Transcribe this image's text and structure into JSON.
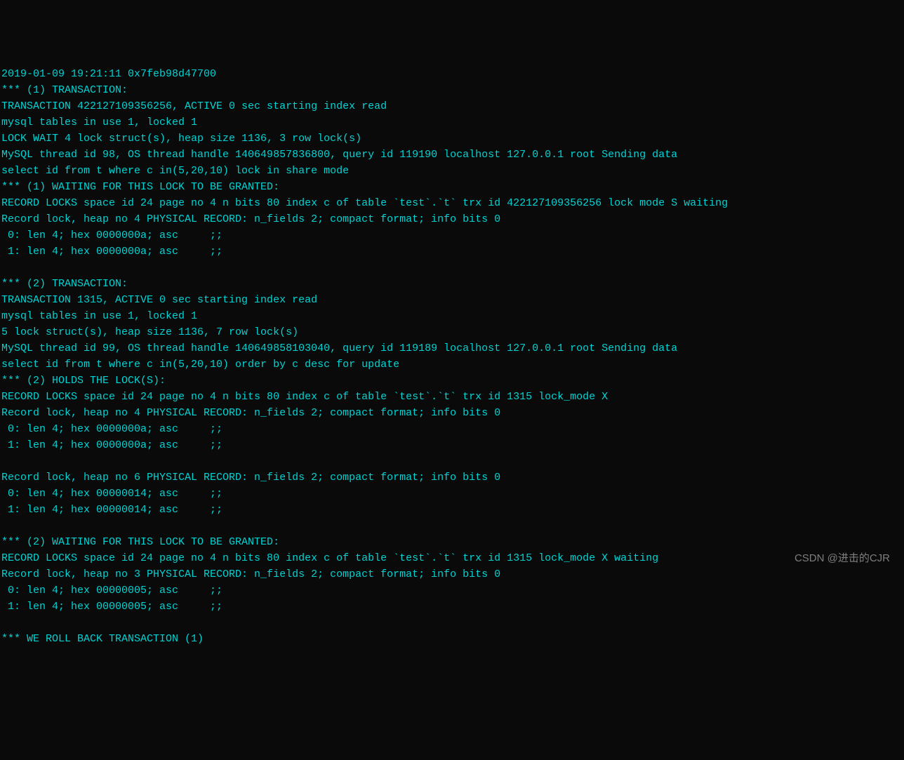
{
  "terminal": {
    "lines": [
      "2019-01-09 19:21:11 0x7feb98d47700",
      "*** (1) TRANSACTION:",
      "TRANSACTION 422127109356256, ACTIVE 0 sec starting index read",
      "mysql tables in use 1, locked 1",
      "LOCK WAIT 4 lock struct(s), heap size 1136, 3 row lock(s)",
      "MySQL thread id 98, OS thread handle 140649857836800, query id 119190 localhost 127.0.0.1 root Sending data",
      "select id from t where c in(5,20,10) lock in share mode",
      "*** (1) WAITING FOR THIS LOCK TO BE GRANTED:",
      "RECORD LOCKS space id 24 page no 4 n bits 80 index c of table `test`.`t` trx id 422127109356256 lock mode S waiting",
      "Record lock, heap no 4 PHYSICAL RECORD: n_fields 2; compact format; info bits 0",
      " 0: len 4; hex 0000000a; asc     ;;",
      " 1: len 4; hex 0000000a; asc     ;;",
      "",
      "*** (2) TRANSACTION:",
      "TRANSACTION 1315, ACTIVE 0 sec starting index read",
      "mysql tables in use 1, locked 1",
      "5 lock struct(s), heap size 1136, 7 row lock(s)",
      "MySQL thread id 99, OS thread handle 140649858103040, query id 119189 localhost 127.0.0.1 root Sending data",
      "select id from t where c in(5,20,10) order by c desc for update",
      "*** (2) HOLDS THE LOCK(S):",
      "RECORD LOCKS space id 24 page no 4 n bits 80 index c of table `test`.`t` trx id 1315 lock_mode X",
      "Record lock, heap no 4 PHYSICAL RECORD: n_fields 2; compact format; info bits 0",
      " 0: len 4; hex 0000000a; asc     ;;",
      " 1: len 4; hex 0000000a; asc     ;;",
      "",
      "Record lock, heap no 6 PHYSICAL RECORD: n_fields 2; compact format; info bits 0",
      " 0: len 4; hex 00000014; asc     ;;",
      " 1: len 4; hex 00000014; asc     ;;",
      "",
      "*** (2) WAITING FOR THIS LOCK TO BE GRANTED:",
      "RECORD LOCKS space id 24 page no 4 n bits 80 index c of table `test`.`t` trx id 1315 lock_mode X waiting",
      "Record lock, heap no 3 PHYSICAL RECORD: n_fields 2; compact format; info bits 0",
      " 0: len 4; hex 00000005; asc     ;;",
      " 1: len 4; hex 00000005; asc     ;;",
      "",
      "*** WE ROLL BACK TRANSACTION (1)"
    ]
  },
  "watermark": "CSDN @进击的CJR"
}
